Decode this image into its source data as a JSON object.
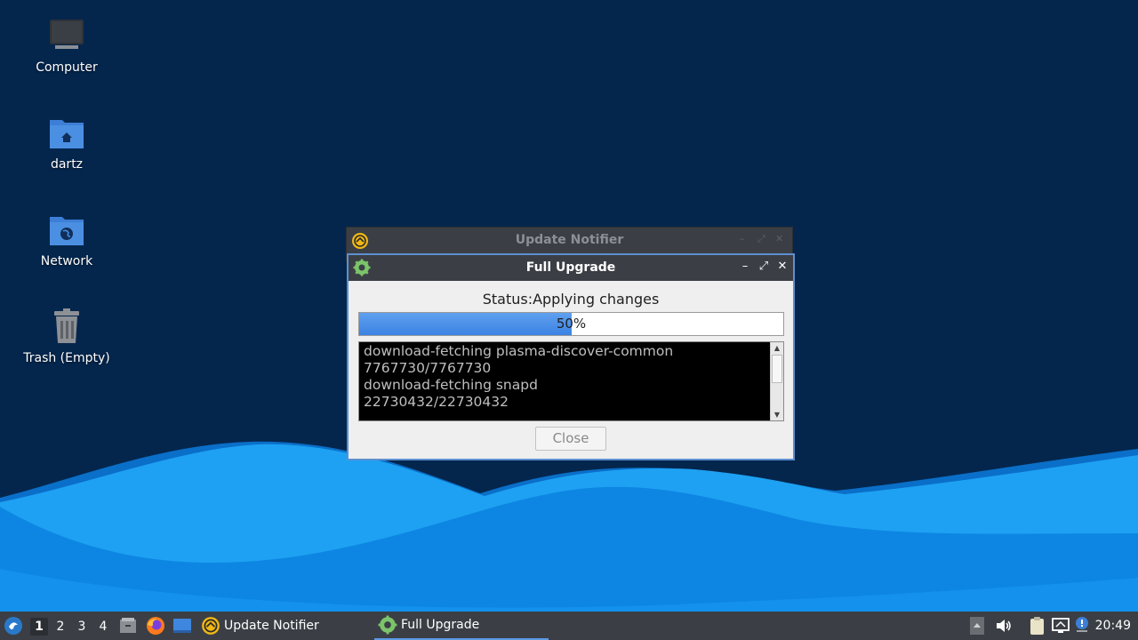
{
  "desktop": {
    "icons": [
      {
        "label": "Computer",
        "icon": "computer-icon"
      },
      {
        "label": "dartz",
        "icon": "home-folder-icon"
      },
      {
        "label": "Network",
        "icon": "network-folder-icon"
      },
      {
        "label": "Trash (Empty)",
        "icon": "trash-icon"
      }
    ]
  },
  "background_window": {
    "title": "Update Notifier",
    "icon": "update-notifier-icon"
  },
  "window": {
    "title": "Full Upgrade",
    "icon": "gear-icon",
    "controls": {
      "minimize": "–",
      "maximize": "⤢",
      "close": "✕"
    },
    "status": "Status:Applying changes",
    "progress": {
      "value": 0.5,
      "label": "50%"
    },
    "log": [
      "download-fetching plasma-discover-common",
      "7767730/7767730",
      "download-fetching snapd",
      "22730432/22730432"
    ],
    "close_button": "Close"
  },
  "taskbar": {
    "workspaces": [
      "1",
      "2",
      "3",
      "4"
    ],
    "active_workspace": "1",
    "launchers": [
      "start-menu-icon",
      "file-manager-icon",
      "firefox-icon",
      "show-desktop-icon"
    ],
    "tasks": [
      {
        "label": "Update Notifier",
        "icon": "update-notifier-icon",
        "active": false
      },
      {
        "label": "Full Upgrade",
        "icon": "gear-icon",
        "active": true
      }
    ],
    "tray": [
      "tray-expand-icon",
      "volume-icon",
      "clipboard-icon",
      "network-icon",
      "notification-icon"
    ],
    "clock": "20:49"
  },
  "colors": {
    "desktop_bg": "#04264d",
    "wave_light": "#1ea1f2",
    "wave_dark": "#0d86e3",
    "titlebar": "#3b3f45",
    "progress": "#3b82e3",
    "window_border": "#5f8fd0"
  }
}
